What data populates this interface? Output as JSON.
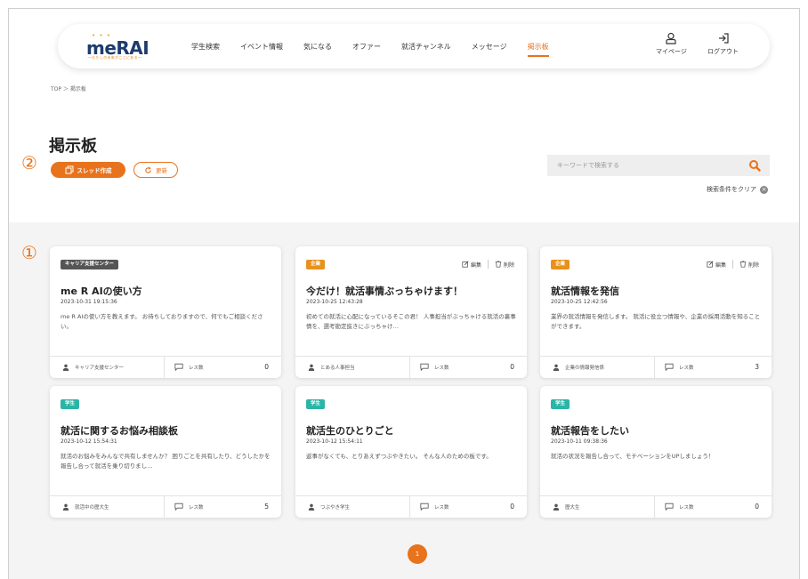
{
  "header": {
    "logo_text": "meRAI",
    "logo_tagline": "〜わたしの未来がここにある〜",
    "nav": [
      {
        "label": "学生検索",
        "active": false
      },
      {
        "label": "イベント情報",
        "active": false
      },
      {
        "label": "気になる",
        "active": false
      },
      {
        "label": "オファー",
        "active": false
      },
      {
        "label": "就活チャンネル",
        "active": false
      },
      {
        "label": "メッセージ",
        "active": false
      },
      {
        "label": "掲示板",
        "active": true
      }
    ],
    "mypage_label": "マイページ",
    "logout_label": "ログアウト"
  },
  "breadcrumb": "TOP ＞ 掲示板",
  "page": {
    "title": "掲示板",
    "create_thread_label": "スレッド作成",
    "refresh_label": "更新",
    "marker_1": "①",
    "marker_2": "②"
  },
  "search": {
    "placeholder": "キーワードで検索する",
    "clear_label": "検索条件をクリア"
  },
  "cards": [
    {
      "badge": "キャリア支援センター",
      "badge_color": "dark",
      "editable": false,
      "title": "me R AIの使い方",
      "date": "2023-10-31 19:15:36",
      "desc": "me R AIの使い方を教えます。 お待ちしておりますので、何でもご相談ください。",
      "user": "キャリア支援センター",
      "res_label": "レス数",
      "res_count": "0"
    },
    {
      "badge": "企業",
      "badge_color": "orange",
      "editable": true,
      "title": "今だけ！就活事情ぶっちゃけます！",
      "date": "2023-10-25 12:43:28",
      "desc": "初めての就活に心配になっているそこの君！ 人事担当がぶっちゃける就活の裏事情を、選考勘定抜きにぶっちゃけ…",
      "user": "とある人事担当",
      "res_label": "レス数",
      "res_count": "0"
    },
    {
      "badge": "企業",
      "badge_color": "orange",
      "editable": true,
      "title": "就活情報を発信",
      "date": "2023-10-25 12:42:56",
      "desc": "業界の就活情報を発信します。 就活に役立つ情報や、企業の採用活動を知ることができます。",
      "user": "企業の情報発信係",
      "res_label": "レス数",
      "res_count": "3"
    },
    {
      "badge": "学生",
      "badge_color": "teal",
      "editable": false,
      "title": "就活に関するお悩み相談板",
      "date": "2023-10-12 15:54:31",
      "desc": "就活のお悩みをみんなで共有しませんか？ 困りごとを共有したり、どうしたかを報告し合って就活を乗り切りまし…",
      "user": "就活中の歴大生",
      "res_label": "レス数",
      "res_count": "5"
    },
    {
      "badge": "学生",
      "badge_color": "teal",
      "editable": false,
      "title": "就活生のひとりごと",
      "date": "2023-10-12 15:54:11",
      "desc": "返事がなくても、とりあえずつぶやきたい。 そんな人のための板です。",
      "user": "つぶやき学生",
      "res_label": "レス数",
      "res_count": "0"
    },
    {
      "badge": "学生",
      "badge_color": "teal",
      "editable": false,
      "title": "就活報告をしたい",
      "date": "2023-10-11 09:38:36",
      "desc": "就活の状況を報告し合って、モチベーションをUPしましょう！",
      "user": "歴大生",
      "res_label": "レス数",
      "res_count": "0"
    }
  ],
  "edit_label": "編集",
  "delete_label": "削除",
  "pagination": {
    "current": "1"
  },
  "colors": {
    "accent": "#e8731d",
    "teal": "#2bb5a7",
    "dark_badge": "#555555",
    "logo": "#1d3b6e"
  }
}
